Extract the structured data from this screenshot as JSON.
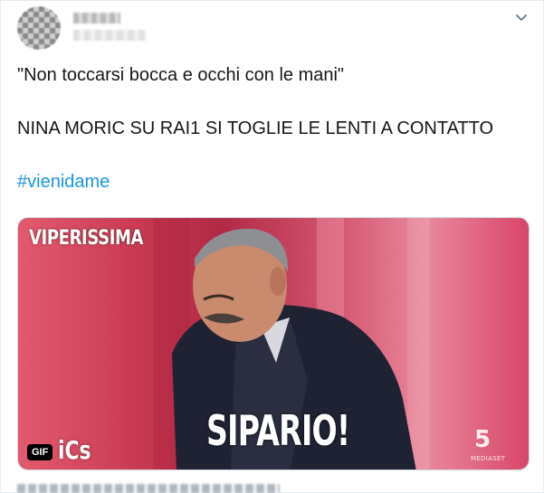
{
  "tweet": {
    "line1": "\"Non toccarsi bocca e occhi con le mani\"",
    "line2": "NINA MORIC SU RAI1 SI TOGLIE LE LENTI A CONTATTO",
    "hashtag": "#vienidame",
    "menu_icon": "chevron-down-icon"
  },
  "media": {
    "show_logo": "VIPERISSIMA",
    "caption": "SIPARIO!",
    "corner_brand": "iCs",
    "gif_badge": "GIF",
    "channel_number": "5",
    "channel_name": "MEDIASET"
  },
  "colors": {
    "hashtag": "#1b95e0",
    "text": "#14171a",
    "icon": "#657786"
  }
}
